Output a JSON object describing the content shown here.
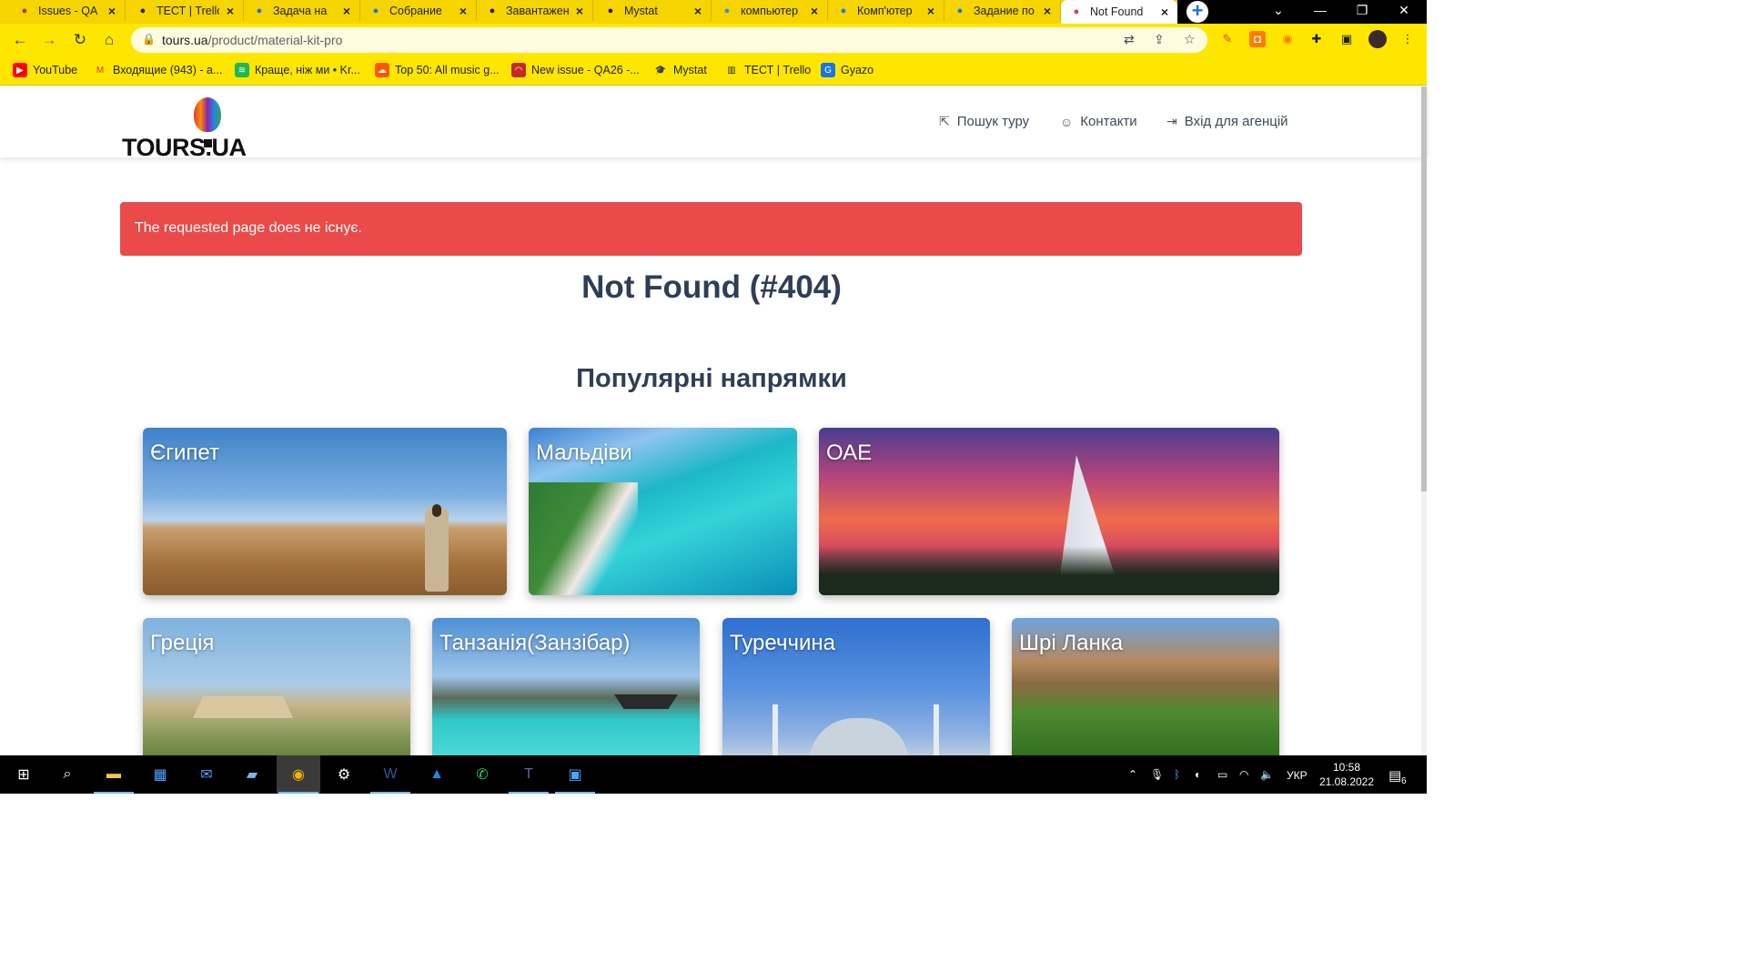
{
  "browser": {
    "tabs": [
      {
        "title": "Issues - QA",
        "icon": "issues-icon",
        "color": "#c62828"
      },
      {
        "title": "ТЕСТ | Trello",
        "icon": "trello-icon",
        "color": "#222222"
      },
      {
        "title": "Задача на",
        "icon": "docs-icon",
        "color": "#1a73e8"
      },
      {
        "title": "Собрание",
        "icon": "docs-icon",
        "color": "#1a73e8"
      },
      {
        "title": "Завантажен",
        "icon": "download-icon",
        "color": "#222222"
      },
      {
        "title": "Mystat",
        "icon": "mystat-icon",
        "color": "#222222"
      },
      {
        "title": "компьютер",
        "icon": "google-icon",
        "color": "#4285f4"
      },
      {
        "title": "Комп'ютер",
        "icon": "facebook-icon",
        "color": "#1877f2"
      },
      {
        "title": "Задание по",
        "icon": "docs-icon",
        "color": "#1a73e8"
      },
      {
        "title": "Not Found",
        "icon": "balloon-icon",
        "color": "#e53935"
      }
    ],
    "window_controls": {
      "chevron": "⌄",
      "minimize": "—",
      "restore": "❐",
      "close": "✕"
    },
    "url_host": "tours.ua",
    "url_path": "/product/material-kit-pro",
    "bookmarks": [
      {
        "label": "YouTube",
        "icon": "youtube-icon",
        "color": "#ff0000",
        "glyph": "▶"
      },
      {
        "label": "Входящие (943) - a...",
        "icon": "gmail-icon",
        "color": "#ffffff",
        "glyph": "M"
      },
      {
        "label": "Краще, ніж ми • Kr...",
        "icon": "spotify-icon",
        "color": "#1db954",
        "glyph": "≋"
      },
      {
        "label": "Top 50: All music g...",
        "icon": "soundcloud-icon",
        "color": "#ff5500",
        "glyph": "☁"
      },
      {
        "label": "New issue - QA26 -...",
        "icon": "issues-icon",
        "color": "#c62828",
        "glyph": "◠"
      },
      {
        "label": "Mystat",
        "icon": "mystat-icon",
        "color": "#222222",
        "glyph": "🎓"
      },
      {
        "label": "ТЕСТ | Trello",
        "icon": "trello-icon",
        "color": "#222222",
        "glyph": "▥"
      },
      {
        "label": "Gyazo",
        "icon": "gyazo-icon",
        "color": "#1a73e8",
        "glyph": "G"
      }
    ]
  },
  "site": {
    "logo_text": "TOURS.UA",
    "nav": [
      {
        "label": "Пошук туру",
        "icon": "search-tour-icon",
        "glyph": "⇱"
      },
      {
        "label": "Контакти",
        "icon": "contacts-icon",
        "glyph": "☺"
      },
      {
        "label": "Вхід для агенцій",
        "icon": "login-icon",
        "glyph": "⇥"
      }
    ],
    "alert_text": "The requested page does не існує.",
    "error_title": "Not Found (#404)",
    "section_title": "Популярні напрямки",
    "destinations": [
      "Єгипет",
      "Мальдіви",
      "ОАЕ",
      "Греція",
      "Танзанія(Занзібар)",
      "Туреччина",
      "Шрі Ланка"
    ],
    "colors": {
      "alert": "#ea4a4a",
      "heading": "#2f3e56"
    }
  },
  "taskbar": {
    "apps": [
      {
        "icon": "windows-start-icon",
        "glyph": "⊞",
        "color": "#ffffff"
      },
      {
        "icon": "search-icon",
        "glyph": "⌕",
        "color": "#ffffff"
      },
      {
        "icon": "file-explorer-icon",
        "glyph": "▬",
        "color": "#f2c94c"
      },
      {
        "icon": "store-icon",
        "glyph": "▦",
        "color": "#4aa3ff"
      },
      {
        "icon": "mail-icon",
        "glyph": "✉",
        "color": "#4aa3ff"
      },
      {
        "icon": "notes-icon",
        "glyph": "▰",
        "color": "#7fb2de"
      },
      {
        "icon": "chrome-icon",
        "glyph": "◉",
        "color": "#f4b400"
      },
      {
        "icon": "settings-icon",
        "glyph": "⚙",
        "color": "#ffffff"
      },
      {
        "icon": "word-icon",
        "glyph": "W",
        "color": "#2b579a"
      },
      {
        "icon": "photos-icon",
        "glyph": "▲",
        "color": "#1e88e5"
      },
      {
        "icon": "whatsapp-icon",
        "glyph": "✆",
        "color": "#25d366"
      },
      {
        "icon": "teams-icon",
        "glyph": "T",
        "color": "#6264a7"
      },
      {
        "icon": "remote-desktop-icon",
        "glyph": "▣",
        "color": "#4aa3ff"
      }
    ],
    "language": "УКР",
    "time": "10:58",
    "date": "21.08.2022",
    "notifications": "6"
  }
}
